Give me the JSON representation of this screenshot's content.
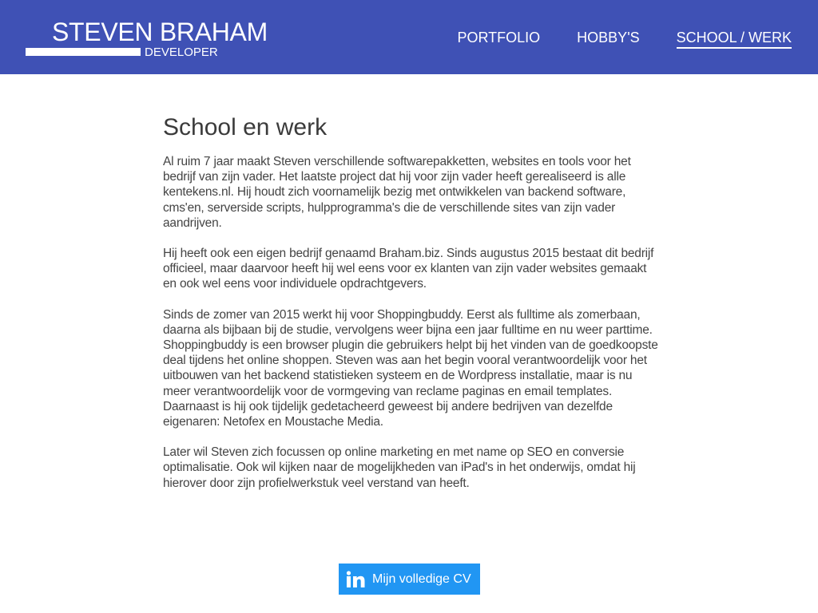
{
  "brand": {
    "name": "STEVEN BRAHAM",
    "tagline": "DEVELOPER"
  },
  "nav": {
    "items": [
      {
        "label": "PORTFOLIO",
        "active": false
      },
      {
        "label": "HOBBY'S",
        "active": false
      },
      {
        "label": "SCHOOL / WERK",
        "active": true
      }
    ]
  },
  "main": {
    "title": "School en werk",
    "paragraphs": [
      "Al ruim 7 jaar maakt Steven verschillende softwarepakketten, websites en tools voor het bedrijf van zijn vader. Het laatste project dat hij voor zijn vader heeft gerealiseerd is alle kentekens.nl. Hij houdt zich voornamelijk bezig met ontwikkelen van backend software, cms'en, serverside scripts, hulpprogramma's die de verschillende sites van zijn vader aandrijven.",
      "Hij heeft ook een eigen bedrijf genaamd Braham.biz. Sinds augustus 2015 bestaat dit bedrijf officieel, maar daarvoor heeft hij wel eens voor ex klanten van zijn vader websites gemaakt en ook wel eens voor individuele opdrachtgevers.",
      "Sinds de zomer van 2015 werkt hij voor Shoppingbuddy. Eerst als fulltime als zomerbaan, daarna als bijbaan bij de studie, vervolgens weer bijna een jaar fulltime en nu weer parttime. Shoppingbuddy is een browser plugin die gebruikers helpt bij het vinden van de goedkoopste deal tijdens het online shoppen. Steven was aan het begin vooral verantwoordelijk voor het uitbouwen van het backend statistieken systeem en de Wordpress installatie, maar is nu meer verantwoordelijk voor de vormgeving van reclame paginas en email templates. Daarnaast is hij ook tijdelijk gedetacheerd geweest bij andere bedrijven van dezelfde eigenaren: Netofex en Moustache Media.",
      "Later wil Steven zich focussen op online marketing en met name op SEO en conversie optimalisatie. Ook wil kijken naar de mogelijkheden van iPad's in het onderwijs, omdat hij hierover door zijn profielwerkstuk veel verstand van heeft."
    ]
  },
  "cv_button": {
    "icon": "linkedin-icon",
    "label": "Mijn volledige CV"
  },
  "colors": {
    "header": "#3f51b5",
    "button": "#2196f3",
    "text": "#444444"
  }
}
